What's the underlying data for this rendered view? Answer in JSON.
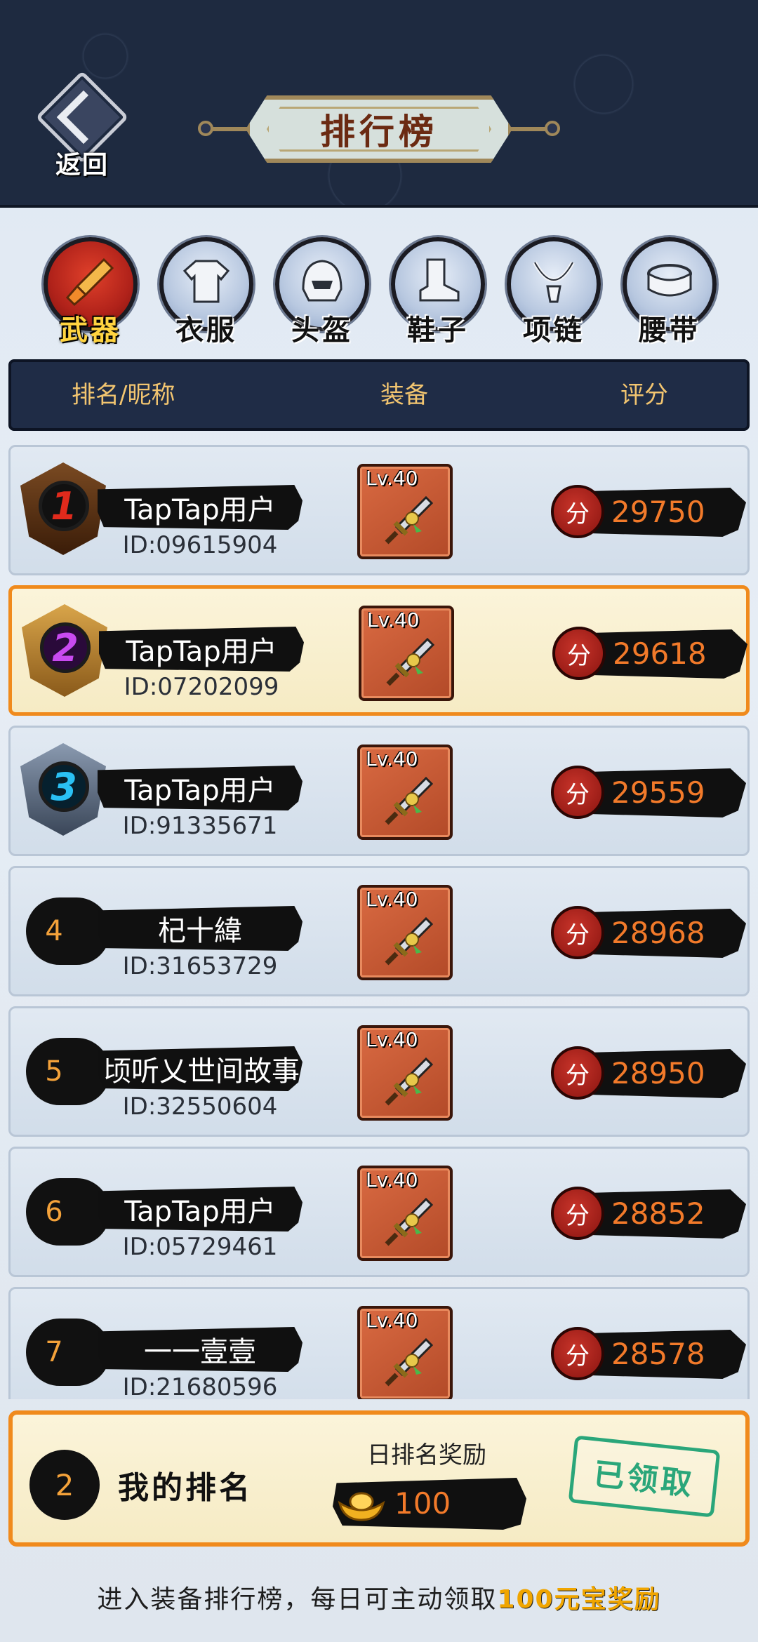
{
  "header": {
    "back_label": "返回",
    "title": "排行榜"
  },
  "tabs": [
    {
      "label": "武器",
      "icon": "brush-weapon-icon",
      "active": true
    },
    {
      "label": "衣服",
      "icon": "clothes-icon",
      "active": false
    },
    {
      "label": "头盔",
      "icon": "helmet-icon",
      "active": false
    },
    {
      "label": "鞋子",
      "icon": "boot-icon",
      "active": false
    },
    {
      "label": "项链",
      "icon": "necklace-icon",
      "active": false
    },
    {
      "label": "腰带",
      "icon": "belt-icon",
      "active": false
    }
  ],
  "columns": {
    "rank_name": "排名/昵称",
    "equipment": "装备",
    "score": "评分"
  },
  "score_seal": "分",
  "rows": [
    {
      "rank": "1",
      "name": "TapTap用户",
      "id": "ID:09615904",
      "level": "Lv.40",
      "score": "29750"
    },
    {
      "rank": "2",
      "name": "TapTap用户",
      "id": "ID:07202099",
      "level": "Lv.40",
      "score": "29618"
    },
    {
      "rank": "3",
      "name": "TapTap用户",
      "id": "ID:91335671",
      "level": "Lv.40",
      "score": "29559"
    },
    {
      "rank": "4",
      "name": "杞十緯",
      "id": "ID:31653729",
      "level": "Lv.40",
      "score": "28968"
    },
    {
      "rank": "5",
      "name": "顷听乂世间故事",
      "id": "ID:32550604",
      "level": "Lv.40",
      "score": "28950"
    },
    {
      "rank": "6",
      "name": "TapTap用户",
      "id": "ID:05729461",
      "level": "Lv.40",
      "score": "28852"
    },
    {
      "rank": "7",
      "name": "一一壹壹",
      "id": "ID:21680596",
      "level": "Lv.40",
      "score": "28578"
    }
  ],
  "my_rank": {
    "rank": "2",
    "label": "我的排名",
    "reward_title": "日排名奖励",
    "reward_value": "100",
    "claimed_stamp": "已领取"
  },
  "footer": {
    "note": "进入装备排行榜，每日可主动领取",
    "highlight": "100元宝奖励"
  },
  "colors": {
    "header_bg": "#1e2a40",
    "accent_orange": "#f08a1c",
    "score_orange": "#f27a2a",
    "rank1_orb": "#c8221a",
    "rank2_orb": "#9b2fd6",
    "rank3_orb": "#1aa6e8",
    "stamp_green": "#2aa67a"
  }
}
